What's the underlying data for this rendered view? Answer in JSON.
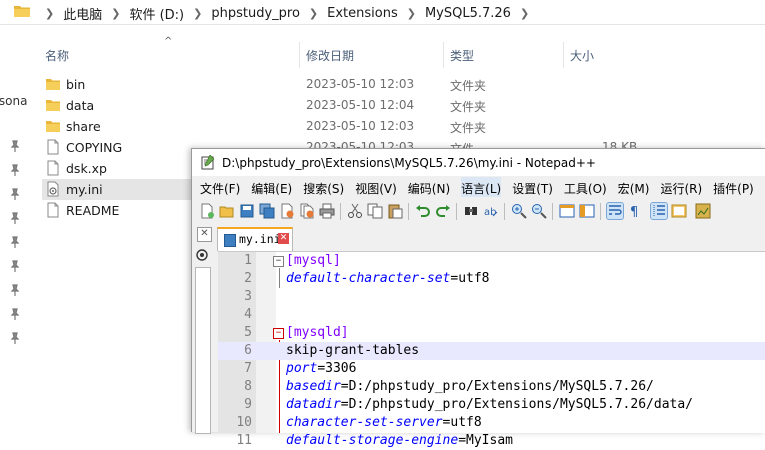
{
  "explorer": {
    "breadcrumb": [
      "此电脑",
      "软件 (D:)",
      "phpstudy_pro",
      "Extensions",
      "MySQL5.7.26"
    ],
    "columns": {
      "name": "名称",
      "date": "修改日期",
      "type": "类型",
      "size": "大小"
    },
    "nav_stub_text": "rsona",
    "files": [
      {
        "name": "bin",
        "date": "2023-05-10 12:03",
        "type": "文件夹",
        "size": "",
        "icon": "folder-icon"
      },
      {
        "name": "data",
        "date": "2023-05-10 12:04",
        "type": "文件夹",
        "size": "",
        "icon": "folder-icon"
      },
      {
        "name": "share",
        "date": "2023-05-10 12:03",
        "type": "文件夹",
        "size": "",
        "icon": "folder-icon"
      },
      {
        "name": "COPYING",
        "date": "2023-05-10 12:03",
        "type": "文件",
        "size": "18 KB",
        "icon": "file-icon"
      },
      {
        "name": "dsk.xp",
        "date": "",
        "type": "",
        "size": "",
        "icon": "file-icon"
      },
      {
        "name": "my.ini",
        "date": "",
        "type": "",
        "size": "",
        "icon": "ini-file-icon"
      },
      {
        "name": "README",
        "date": "",
        "type": "",
        "size": "",
        "icon": "file-icon"
      }
    ]
  },
  "notepad": {
    "title": "D:\\phpstudy_pro\\Extensions\\MySQL5.7.26\\my.ini - Notepad++",
    "menu": [
      "文件(F)",
      "编辑(E)",
      "搜索(S)",
      "视图(V)",
      "编码(N)",
      "语言(L)",
      "设置(T)",
      "工具(O)",
      "宏(M)",
      "运行(R)",
      "插件(P)"
    ],
    "tab_label": "my.ini",
    "lines": [
      {
        "n": "1",
        "kind": "section",
        "text": "[mysql]"
      },
      {
        "n": "2",
        "kind": "kv",
        "key": "default-character-set",
        "value": "utf8"
      },
      {
        "n": "3",
        "kind": "blank",
        "text": ""
      },
      {
        "n": "4",
        "kind": "blank",
        "text": ""
      },
      {
        "n": "5",
        "kind": "section",
        "text": "[mysqld]"
      },
      {
        "n": "6",
        "kind": "plain",
        "text": "skip-grant-tables"
      },
      {
        "n": "7",
        "kind": "kv",
        "key": "port",
        "value": "3306"
      },
      {
        "n": "8",
        "kind": "kv",
        "key": "basedir",
        "value": "D:/phpstudy_pro/Extensions/MySQL5.7.26/"
      },
      {
        "n": "9",
        "kind": "kv",
        "key": "datadir",
        "value": "D:/phpstudy_pro/Extensions/MySQL5.7.26/data/"
      },
      {
        "n": "10",
        "kind": "kv",
        "key": "character-set-server",
        "value": "utf8"
      },
      {
        "n": "11",
        "kind": "kv",
        "key": "default-storage-engine",
        "value": "MyIsam"
      }
    ]
  },
  "colors": {
    "section": "#8000ff",
    "key": "#0000ff",
    "current_line": "#e8e8ff",
    "tab_accent": "#f5a623"
  }
}
